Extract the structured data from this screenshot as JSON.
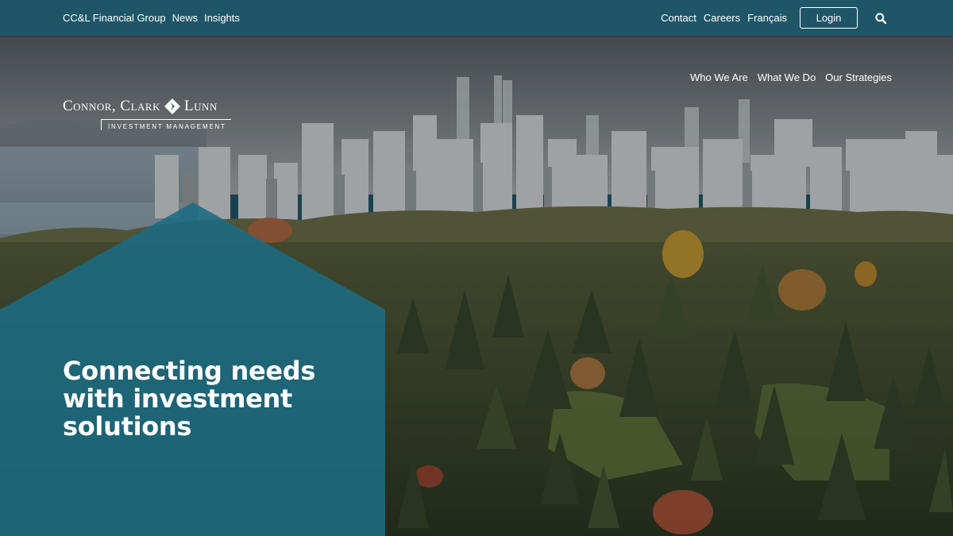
{
  "topbar": {
    "left_links": [
      "CC&L Financial Group",
      "News",
      "Insights"
    ],
    "right_links": [
      "Contact",
      "Careers",
      "Français"
    ],
    "login_label": "Login",
    "search_icon": "search-icon"
  },
  "logo": {
    "name": "Connor, Clark",
    "name_part2": "Lunn",
    "sub": "INVESTMENT MANAGEMENT"
  },
  "main_nav": [
    "Who We Are",
    "What We Do",
    "Our Strategies"
  ],
  "hero": {
    "headline": "Connecting needs with investment solutions"
  },
  "colors": {
    "topbar": "#1f5667",
    "panel": "#1b6b82",
    "text": "#ffffff"
  }
}
